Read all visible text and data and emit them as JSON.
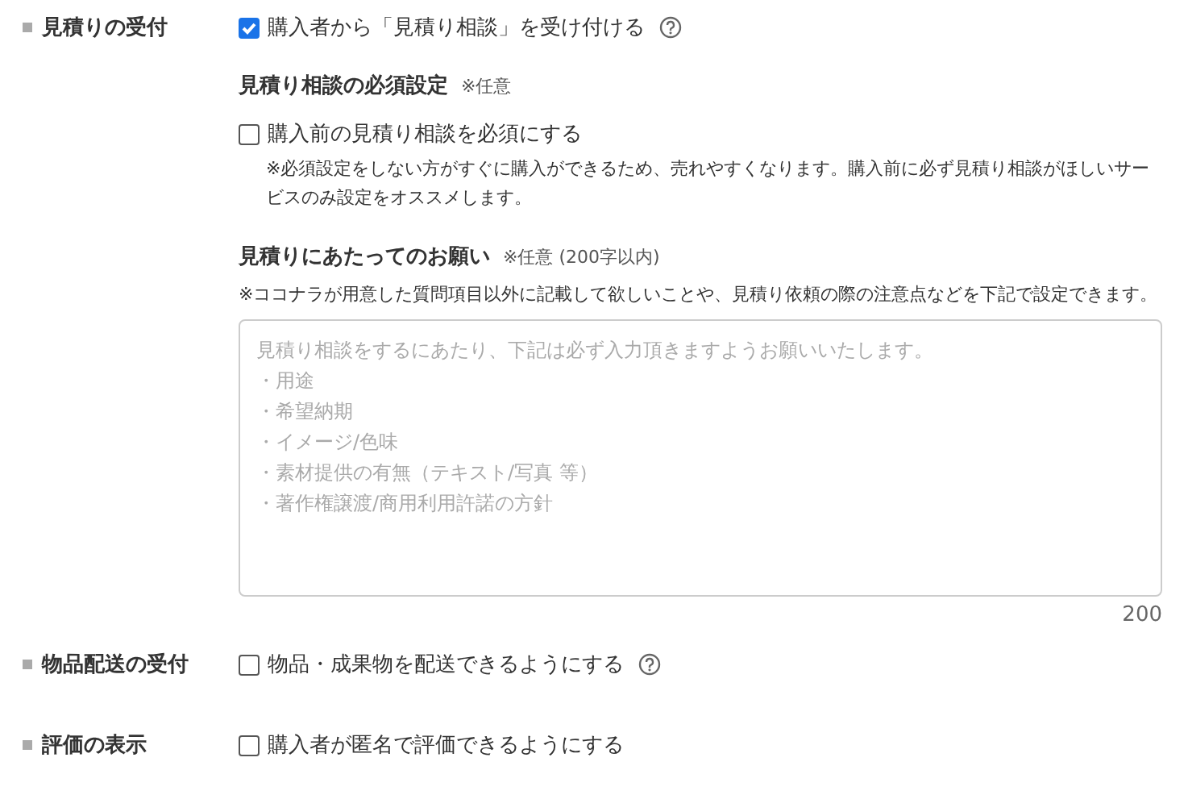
{
  "rows": [
    {
      "label": "見積りの受付",
      "option": {
        "text": "購入者から「見積り相談」を受け付ける",
        "checked": true,
        "help": true
      },
      "sections": [
        {
          "kind": "checkbox",
          "title": "見積り相談の必須設定",
          "hint": "※任意",
          "option": {
            "text": "購入前の見積り相談を必須にする",
            "checked": false
          },
          "note": "※必須設定をしない方がすぐに購入ができるため、売れやすくなります。購入前に必ず見積り相談がほしいサービスのみ設定をオススメします。"
        },
        {
          "kind": "textarea",
          "title": "見積りにあたってのお願い",
          "hint": "※任意 (200字以内)",
          "description": "※ココナラが用意した質問項目以外に記載して欲しいことや、見積り依頼の際の注意点などを下記で設定できます。",
          "placeholder_lines": [
            "見積り相談をするにあたり、下記は必ず入力頂きますようお願いいたします。",
            "・用途",
            "・希望納期",
            "・イメージ/色味",
            "・素材提供の有無（テキスト/写真 等）",
            "・著作権譲渡/商用利用許諾の方針"
          ],
          "counter": "200"
        }
      ]
    },
    {
      "label": "物品配送の受付",
      "option": {
        "text": "物品・成果物を配送できるようにする",
        "checked": false,
        "help": true
      }
    },
    {
      "label": "評価の表示",
      "option": {
        "text": "購入者が匿名で評価できるようにする",
        "checked": false,
        "help": false
      }
    }
  ]
}
